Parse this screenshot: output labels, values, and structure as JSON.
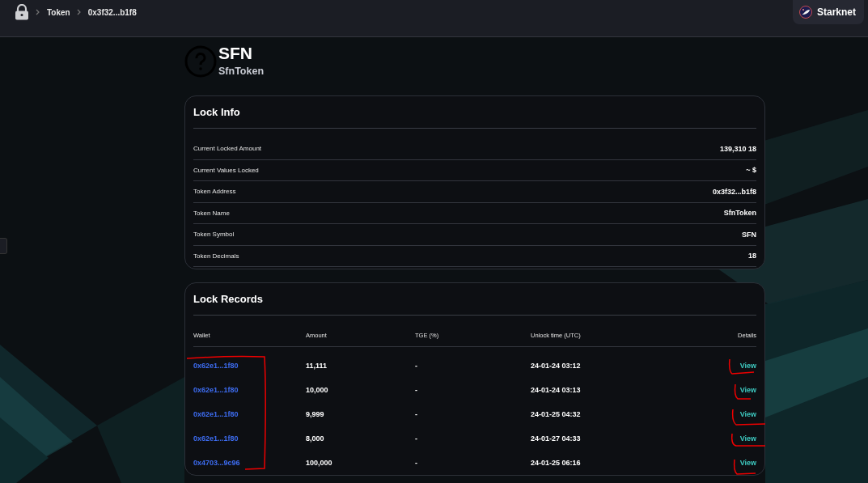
{
  "breadcrumb": [
    {
      "label": "Token"
    },
    {
      "label": "0x3f32...b1f8"
    }
  ],
  "network": {
    "label": "Starknet"
  },
  "token": {
    "symbol": "SFN",
    "name": "SfnToken"
  },
  "lock_info": {
    "title": "Lock Info",
    "rows": [
      {
        "label": "Current Locked Amount",
        "value": "139,310 18"
      },
      {
        "label": "Current Values Locked",
        "value": "~ $"
      },
      {
        "label": "Token Address",
        "value": "0x3f32...b1f8"
      },
      {
        "label": "Token Name",
        "value": "SfnToken"
      },
      {
        "label": "Token Symbol",
        "value": "SFN"
      },
      {
        "label": "Token Decimals",
        "value": "18"
      }
    ]
  },
  "lock_records": {
    "title": "Lock Records",
    "columns": [
      "Wallet",
      "Amount",
      "TGE (%)",
      "Unlock time (UTC)",
      "Details"
    ],
    "rows": [
      {
        "wallet": "0x62e1...1f80",
        "amount": "11,111",
        "tge": "-",
        "unlock": "24-01-24 03:12",
        "details": "View"
      },
      {
        "wallet": "0x62e1...1f80",
        "amount": "10,000",
        "tge": "-",
        "unlock": "24-01-24 03:13",
        "details": "View"
      },
      {
        "wallet": "0x62e1...1f80",
        "amount": "9,999",
        "tge": "-",
        "unlock": "24-01-25 04:32",
        "details": "View"
      },
      {
        "wallet": "0x62e1...1f80",
        "amount": "8,000",
        "tge": "-",
        "unlock": "24-01-27 04:33",
        "details": "View"
      },
      {
        "wallet": "0x4703...9c96",
        "amount": "100,000",
        "tge": "-",
        "unlock": "24-01-25 06:16",
        "details": "View"
      }
    ]
  }
}
